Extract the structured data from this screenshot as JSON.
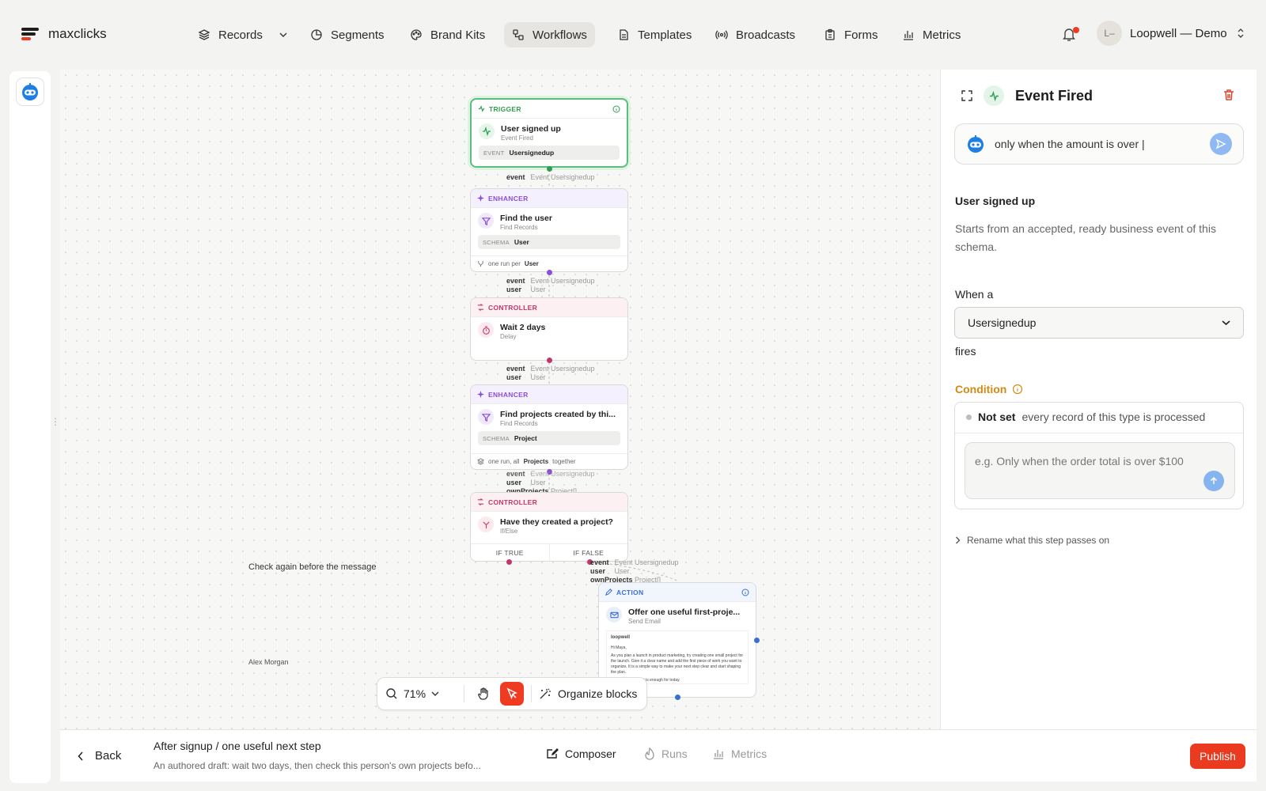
{
  "app": {
    "name": "maxclicks"
  },
  "nav": {
    "items": [
      {
        "label": "Records",
        "icon": "layers-icon"
      },
      {
        "label": "Segments",
        "icon": "pie-icon"
      },
      {
        "label": "Brand Kits",
        "icon": "palette-icon"
      },
      {
        "label": "Workflows",
        "icon": "workflow-icon",
        "active": true
      },
      {
        "label": "Templates",
        "icon": "document-icon"
      },
      {
        "label": "Broadcasts",
        "icon": "broadcast-icon"
      },
      {
        "label": "Forms",
        "icon": "clipboard-icon"
      },
      {
        "label": "Metrics",
        "icon": "bar-chart-icon"
      }
    ],
    "account": {
      "initials": "L–",
      "name": "Loopwell — Demo"
    }
  },
  "canvas": {
    "nodes": {
      "trigger": {
        "type": "TRIGGER",
        "title": "User signed up",
        "subtitle": "Event Fired",
        "pill_key": "EVENT",
        "pill_value": "Usersignedup"
      },
      "enhancer1": {
        "type": "ENHANCER",
        "title": "Find the user",
        "subtitle": "Find Records",
        "pill_key": "SCHEMA",
        "pill_value": "User",
        "foot_prefix": "one run per",
        "foot_value": "User"
      },
      "controller1": {
        "type": "CONTROLLER",
        "title": "Wait 2 days",
        "subtitle": "Delay"
      },
      "enhancer2": {
        "type": "ENHANCER",
        "title": "Find projects created by thi...",
        "subtitle": "Find Records",
        "pill_key": "SCHEMA",
        "pill_value": "Project",
        "foot_prefix": "one run, all",
        "foot_value": "Projects",
        "foot_suffix": "together"
      },
      "controller2": {
        "type": "CONTROLLER",
        "title": "Have they created a project?",
        "subtitle": "If/Else",
        "branch_true": "IF TRUE",
        "branch_false": "IF FALSE"
      },
      "action": {
        "type": "ACTION",
        "title": "Offer one useful first-proje...",
        "subtitle": "Send Email",
        "email_brand": "loopwell",
        "email_greeting": "Hi Maya,",
        "email_body": "As you plan a launch in product marketing, try creating one small project for the launch. Give it a clear name and add the first piece of work you want to organize. It is a simple way to make your next step clear and start shaping the plan.",
        "email_footer": "one next step. That is enough for today."
      }
    },
    "flow_labels": {
      "l1": {
        "key": "event",
        "value": "Event Usersignedup"
      },
      "l2a": {
        "key": "event",
        "value": "Event Usersignedup"
      },
      "l2b": {
        "key": "user",
        "value": "User"
      },
      "l3a": {
        "key": "event",
        "value": "Event Usersignedup"
      },
      "l3b": {
        "key": "user",
        "value": "User"
      },
      "l4a": {
        "key": "event",
        "value": "Event Usersignedup"
      },
      "l4b": {
        "key": "user",
        "value": "User"
      },
      "l4c": {
        "key": "ownProjects",
        "value": "Project[]"
      },
      "l5a": {
        "key": "event",
        "value": "Event Usersignedup"
      },
      "l5b": {
        "key": "user",
        "value": "User"
      },
      "l5c": {
        "key": "ownProjects",
        "value": "Project[]"
      }
    },
    "notes": {
      "check_again": "Check again before the message",
      "author": "Alex Morgan"
    },
    "toolbar": {
      "zoom": "71%",
      "organize": "Organize blocks"
    }
  },
  "panel": {
    "title": "Event Fired",
    "ai_input_value": "only when the amount is over |",
    "section_title": "User signed up",
    "description": "Starts from an accepted, ready business event of this schema.",
    "when_label": "When a",
    "event_select": "Usersignedup",
    "fires_label": "fires",
    "condition_label": "Condition",
    "not_set": "Not set",
    "not_set_desc": "every record of this type is processed",
    "condition_placeholder": "e.g. Only when the order total is over $100",
    "rename_label": "Rename what this step passes on"
  },
  "bottom": {
    "back": "Back",
    "workflow_title": "After signup / one useful next step",
    "workflow_desc": "An authored draft: wait two days, then check this person's own projects befo...",
    "tabs": [
      {
        "label": "Composer",
        "active": true
      },
      {
        "label": "Runs",
        "active": false
      },
      {
        "label": "Metrics",
        "active": false
      }
    ],
    "publish": "Publish"
  },
  "colors": {
    "accent": "#ee3b22",
    "trigger": "#2f9e55",
    "enhancer": "#8a4fd8",
    "controller": "#c2376b",
    "action": "#3a6fd4",
    "condition": "#d38a14"
  }
}
